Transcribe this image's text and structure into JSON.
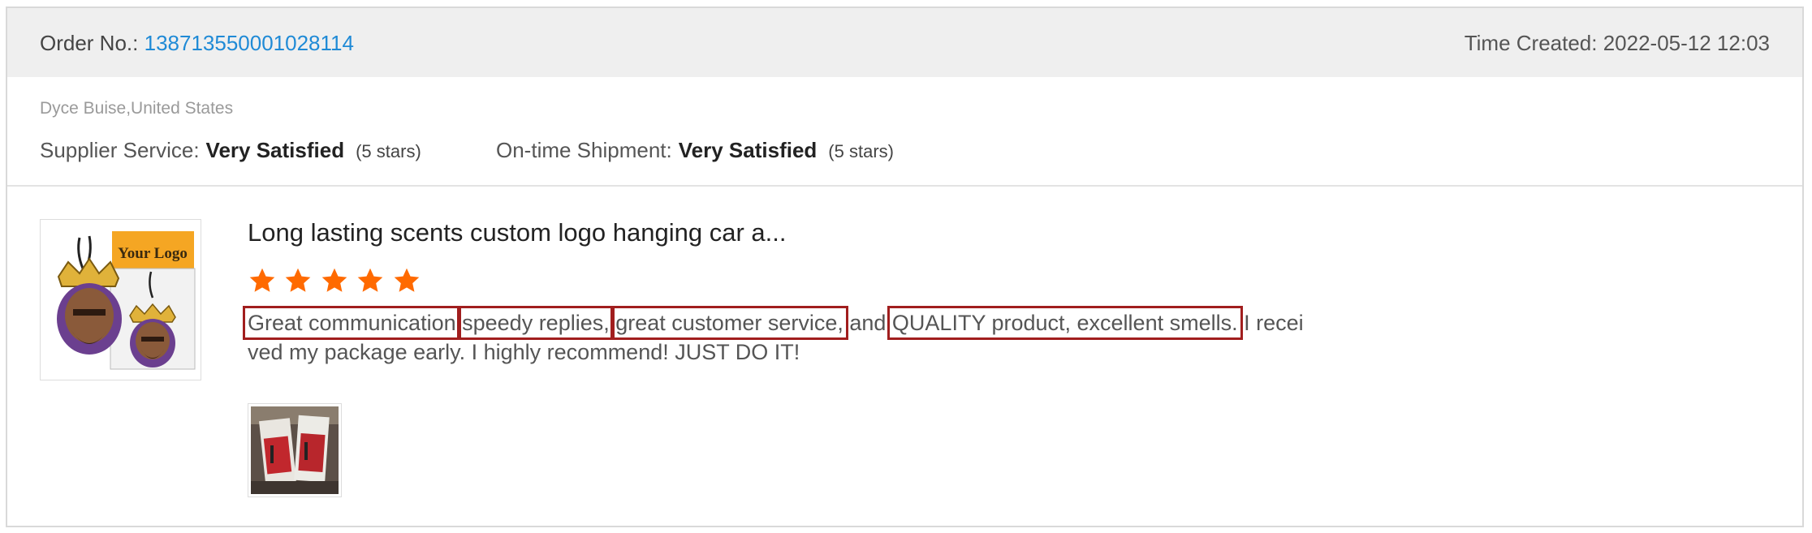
{
  "order": {
    "label": "Order No.:",
    "number": "138713550001028114",
    "time_created": "Time Created: 2022-05-12 12:03"
  },
  "buyer": {
    "name_location": "Dyce Buise,United States"
  },
  "ratings": {
    "supplier": {
      "label": "Supplier Service:",
      "value": "Very Satisfied",
      "stars_text": "(5 stars)"
    },
    "shipment": {
      "label": "On-time Shipment:",
      "value": "Very Satisfied",
      "stars_text": "(5 stars)"
    }
  },
  "product": {
    "title": "Long lasting scents custom logo hanging car a...",
    "thumb_logo_text": "Your Logo",
    "thumb_icon": "air-freshener-product-image",
    "rating": 5,
    "rating_max": 5
  },
  "review": {
    "segments": [
      {
        "text": "Great communication",
        "highlighted": true
      },
      {
        "text": ",",
        "highlighted": false
      },
      {
        "text": "speedy replies,",
        "highlighted": true
      },
      {
        "text": " ",
        "highlighted": false
      },
      {
        "text": "great customer service,",
        "highlighted": true
      },
      {
        "text": " and ",
        "highlighted": false
      },
      {
        "text": "QUALITY product, excellent smells.",
        "highlighted": true
      },
      {
        "text": " I received my package early. I highly recommend! JUST DO IT!",
        "highlighted": false
      }
    ],
    "photo_icon": "review-photo-image"
  },
  "colors": {
    "order_number": "#1f8ad6",
    "star": "#ff6a00",
    "highlight_box": "#a11e1e",
    "header_bg": "#efefef"
  }
}
